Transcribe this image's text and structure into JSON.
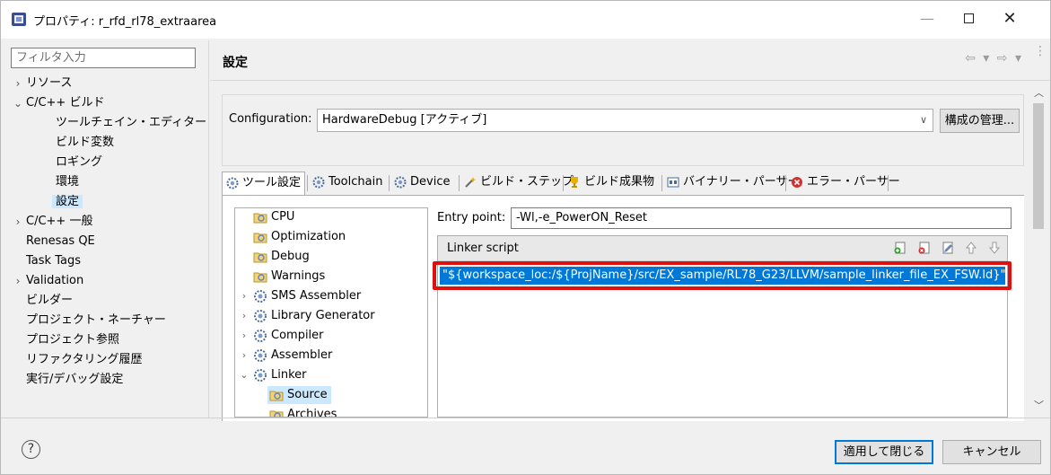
{
  "window": {
    "title": "プロパティ: r_rfd_rl78_extraarea",
    "minimize": "—",
    "close": "✕"
  },
  "sidebar": {
    "filter_placeholder": "フィルタ入力",
    "items": [
      {
        "label": "リソース",
        "arrow": "›"
      },
      {
        "label": "C/C++ ビルド",
        "arrow": "⌄"
      },
      {
        "label": "ツールチェイン・エディター"
      },
      {
        "label": "ビルド変数"
      },
      {
        "label": "ロギング"
      },
      {
        "label": "環境"
      },
      {
        "label": "設定"
      },
      {
        "label": "C/C++ 一般",
        "arrow": "›"
      },
      {
        "label": "Renesas QE"
      },
      {
        "label": "Task Tags"
      },
      {
        "label": "Validation",
        "arrow": "›"
      },
      {
        "label": "ビルダー"
      },
      {
        "label": "プロジェクト・ネーチャー"
      },
      {
        "label": "プロジェクト参照"
      },
      {
        "label": "リファクタリング履歴"
      },
      {
        "label": "実行/デバッグ設定"
      }
    ]
  },
  "header": {
    "title": "設定",
    "nav": "⇦ ▾ ⇨ ▾",
    "more": "⋮"
  },
  "configuration": {
    "label": "Configuration:",
    "value": "HardwareDebug  [アクティブ]",
    "manage_button": "構成の管理..."
  },
  "tabs": [
    {
      "label": "ツール設定",
      "icon": "gear-icon"
    },
    {
      "label": "Toolchain",
      "icon": "gear-icon"
    },
    {
      "label": "Device",
      "icon": "gear-icon"
    },
    {
      "label": "ビルド・ステップ",
      "icon": "wand-icon"
    },
    {
      "label": "ビルド成果物",
      "icon": "trophy-icon"
    },
    {
      "label": "バイナリー・パーサー",
      "icon": "binary-icon"
    },
    {
      "label": "エラー・パーサー",
      "icon": "error-icon"
    }
  ],
  "tool_tree": {
    "items": [
      {
        "label": "CPU"
      },
      {
        "label": "Optimization"
      },
      {
        "label": "Debug"
      },
      {
        "label": "Warnings"
      },
      {
        "label": "SMS Assembler",
        "arrow": "›"
      },
      {
        "label": "Library Generator",
        "arrow": "›"
      },
      {
        "label": "Compiler",
        "arrow": "›"
      },
      {
        "label": "Assembler",
        "arrow": "›"
      },
      {
        "label": "Linker",
        "arrow": "⌄"
      },
      {
        "label": "Source"
      },
      {
        "label": "Archives"
      }
    ]
  },
  "entry_point": {
    "label": "Entry point:",
    "value": "-Wl,-e_PowerON_Reset"
  },
  "linker_script": {
    "title": "Linker script",
    "rows": [
      "\"${workspace_loc:/${ProjName}/src/EX_sample/RL78_G23/LLVM/sample_linker_file_EX_FSW.ld}\""
    ]
  },
  "footer": {
    "help": "?",
    "apply_close": "適用して閉じる",
    "cancel": "キャンセル"
  },
  "colors": {
    "selection": "#0078d7",
    "highlight_frame": "#e01010",
    "tree_selected": "#cce8ff"
  }
}
